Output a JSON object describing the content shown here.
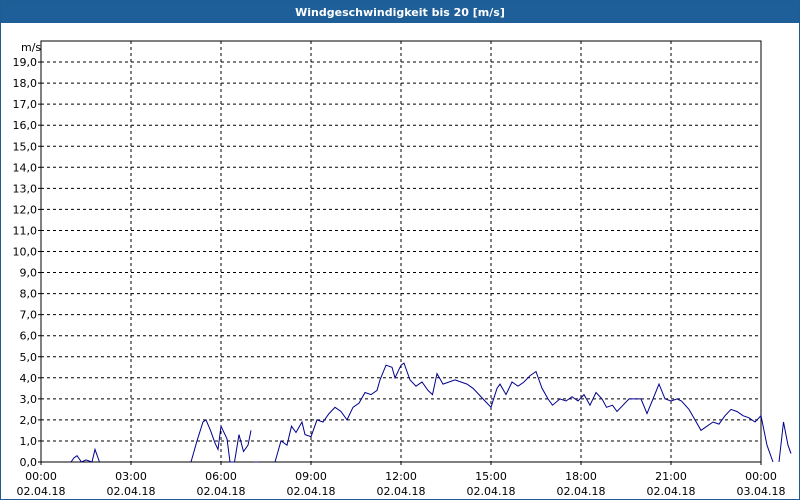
{
  "window": {
    "title": "Windgeschwindigkeit bis 20 [m/s]"
  },
  "chart_data": {
    "type": "line",
    "title": "Windgeschwindigkeit bis 20 [m/s]",
    "ylabel": "m/s",
    "ylim": [
      0,
      20
    ],
    "y_ticks": [
      "0,0",
      "1,0",
      "2,0",
      "3,0",
      "4,0",
      "5,0",
      "6,0",
      "7,0",
      "8,0",
      "9,0",
      "10,0",
      "11,0",
      "12,0",
      "13,0",
      "14,0",
      "15,0",
      "16,0",
      "17,0",
      "18,0",
      "19,0"
    ],
    "x_range": [
      "02.04.18 00:00",
      "03.04.18 00:00"
    ],
    "x_ticks": [
      {
        "time": "00:00",
        "date": "02.04.18"
      },
      {
        "time": "03:00",
        "date": "02.04.18"
      },
      {
        "time": "06:00",
        "date": "02.04.18"
      },
      {
        "time": "09:00",
        "date": "02.04.18"
      },
      {
        "time": "12:00",
        "date": "02.04.18"
      },
      {
        "time": "15:00",
        "date": "02.04.18"
      },
      {
        "time": "18:00",
        "date": "02.04.18"
      },
      {
        "time": "21:00",
        "date": "02.04.18"
      },
      {
        "time": "00:00",
        "date": "03.04.18"
      }
    ],
    "grid": true,
    "line_color": "#00008b",
    "series": [
      {
        "segments": [
          [
            [
              1.0,
              0.0
            ],
            [
              1.1,
              0.2
            ],
            [
              1.2,
              0.3
            ],
            [
              1.35,
              0.0
            ],
            [
              1.5,
              0.1
            ],
            [
              1.7,
              0.0
            ],
            [
              1.8,
              0.6
            ],
            [
              1.95,
              0.0
            ]
          ],
          [
            [
              5.0,
              0.0
            ],
            [
              5.2,
              1.0
            ],
            [
              5.4,
              1.9
            ],
            [
              5.5,
              2.0
            ],
            [
              5.65,
              1.5
            ],
            [
              5.8,
              0.9
            ],
            [
              5.9,
              0.6
            ],
            [
              6.0,
              1.7
            ],
            [
              6.2,
              1.1
            ],
            [
              6.3,
              0.0
            ],
            [
              6.45,
              0.0
            ],
            [
              6.6,
              1.3
            ],
            [
              6.75,
              0.5
            ],
            [
              6.9,
              0.8
            ],
            [
              7.0,
              1.5
            ]
          ],
          [
            [
              7.1,
              0.0
            ],
            [
              7.25,
              0.0
            ]
          ],
          [
            [
              7.8,
              0.0
            ],
            [
              8.0,
              1.0
            ],
            [
              8.2,
              0.8
            ],
            [
              8.35,
              1.7
            ],
            [
              8.5,
              1.4
            ],
            [
              8.7,
              1.9
            ],
            [
              8.8,
              1.3
            ],
            [
              9.0,
              1.2
            ],
            [
              9.2,
              2.0
            ],
            [
              9.4,
              1.9
            ],
            [
              9.6,
              2.3
            ],
            [
              9.8,
              2.6
            ],
            [
              10.0,
              2.4
            ],
            [
              10.2,
              2.0
            ],
            [
              10.4,
              2.6
            ],
            [
              10.6,
              2.8
            ],
            [
              10.8,
              3.3
            ],
            [
              11.0,
              3.2
            ],
            [
              11.2,
              3.4
            ],
            [
              11.3,
              3.9
            ],
            [
              11.5,
              4.6
            ],
            [
              11.7,
              4.5
            ],
            [
              11.8,
              4.0
            ],
            [
              12.0,
              4.6
            ],
            [
              12.1,
              4.7
            ],
            [
              12.3,
              3.9
            ],
            [
              12.5,
              3.6
            ],
            [
              12.7,
              3.8
            ],
            [
              12.9,
              3.4
            ],
            [
              13.05,
              3.2
            ],
            [
              13.2,
              4.2
            ],
            [
              13.4,
              3.7
            ],
            [
              13.6,
              3.8
            ],
            [
              13.8,
              3.9
            ],
            [
              14.0,
              3.8
            ],
            [
              14.2,
              3.7
            ],
            [
              14.4,
              3.5
            ],
            [
              14.6,
              3.2
            ],
            [
              14.8,
              2.9
            ],
            [
              15.0,
              2.6
            ],
            [
              15.2,
              3.5
            ],
            [
              15.3,
              3.7
            ],
            [
              15.5,
              3.2
            ],
            [
              15.7,
              3.8
            ],
            [
              15.9,
              3.6
            ],
            [
              16.1,
              3.8
            ],
            [
              16.3,
              4.1
            ],
            [
              16.5,
              4.3
            ],
            [
              16.7,
              3.5
            ],
            [
              16.9,
              3.0
            ],
            [
              17.05,
              2.7
            ],
            [
              17.3,
              3.0
            ],
            [
              17.5,
              2.9
            ],
            [
              17.7,
              3.1
            ],
            [
              17.9,
              2.9
            ],
            [
              18.1,
              3.2
            ],
            [
              18.3,
              2.7
            ],
            [
              18.5,
              3.3
            ],
            [
              18.7,
              3.0
            ],
            [
              18.85,
              2.6
            ],
            [
              19.05,
              2.7
            ],
            [
              19.2,
              2.4
            ],
            [
              19.4,
              2.7
            ],
            [
              19.6,
              3.0
            ],
            [
              19.8,
              3.0
            ],
            [
              20.0,
              3.0
            ],
            [
              20.2,
              2.3
            ],
            [
              20.4,
              3.0
            ],
            [
              20.6,
              3.7
            ],
            [
              20.8,
              3.0
            ],
            [
              21.0,
              2.9
            ],
            [
              21.2,
              3.0
            ],
            [
              21.35,
              2.9
            ],
            [
              21.6,
              2.5
            ],
            [
              21.8,
              2.0
            ],
            [
              22.0,
              1.5
            ],
            [
              22.2,
              1.7
            ],
            [
              22.4,
              1.9
            ],
            [
              22.6,
              1.8
            ],
            [
              22.8,
              2.2
            ],
            [
              23.0,
              2.5
            ],
            [
              23.2,
              2.4
            ],
            [
              23.4,
              2.2
            ],
            [
              23.6,
              2.1
            ],
            [
              23.8,
              1.9
            ],
            [
              24.0,
              2.2
            ],
            [
              24.2,
              0.8
            ],
            [
              24.4,
              0.0
            ]
          ],
          [
            [
              24.6,
              0.0
            ],
            [
              24.75,
              1.9
            ],
            [
              24.9,
              0.8
            ],
            [
              25.0,
              0.4
            ]
          ]
        ]
      }
    ]
  }
}
